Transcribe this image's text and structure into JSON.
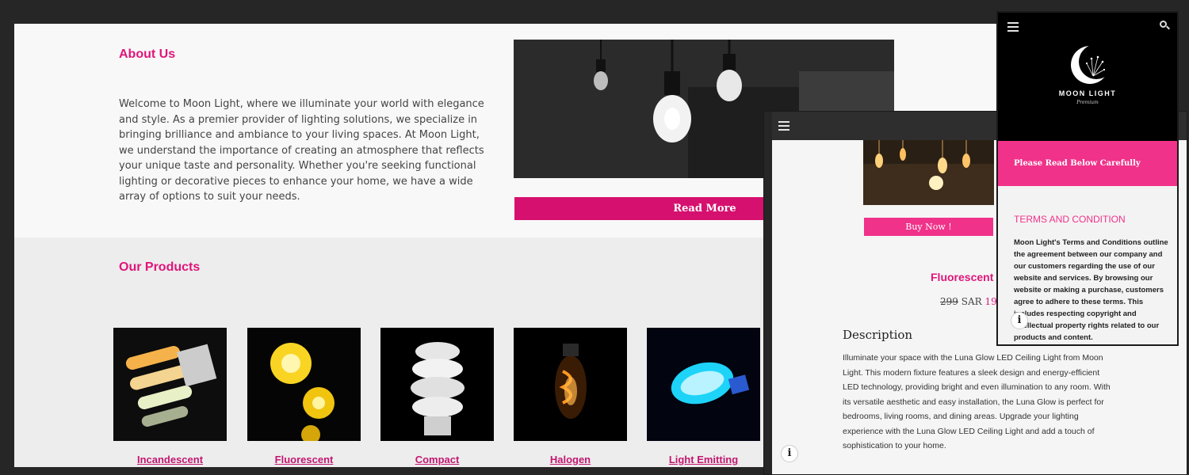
{
  "desktop": {
    "about": {
      "title": "About Us",
      "text": "Welcome to Moon Light, where we illuminate your world with elegance and style. As a premier provider of lighting solutions, we specialize in bringing brilliance and ambiance to your living spaces. At Moon Light, we understand the importance of creating an atmosphere that reflects your unique taste and personality. Whether you're seeking functional lighting or decorative pieces to enhance your home, we have a wide array of options to suit your needs.",
      "read_more_label": "Read More"
    },
    "products": {
      "title": "Our Products",
      "items": [
        {
          "label": "Incandescent"
        },
        {
          "label": "Fluorescent "
        },
        {
          "label": "Compact"
        },
        {
          "label": "Halogen"
        },
        {
          "label": " Light Emitting"
        }
      ]
    }
  },
  "product_window": {
    "buy_label": "Buy Now !",
    "name": "Fluorescent I",
    "old_price": "299",
    "currency": "SAR",
    "new_price": "19",
    "description_title": "Description",
    "description": "Illuminate your space with the Luna Glow LED Ceiling Light from Moon Light. This modern fixture features a sleek design and energy-efficient LED technology, providing bright and even illumination to any room. With its versatile aesthetic and easy installation, the Luna Glow is perfect for bedrooms, living rooms, and dining areas. Upgrade your lighting experience with the Luna Glow LED Ceiling Light and add a touch of sophistication to your home."
  },
  "terms_window": {
    "brand": "MOON LIGHT",
    "brand_sub": "Premium",
    "notice": "Please Read Below Carefully",
    "title": "TERMS AND CONDITION",
    "text": "Moon Light's Terms and Conditions outline the agreement between our company and our customers regarding the use of our website and services. By browsing our website or making a purchase, customers agree to adhere to these terms. This includes respecting copyright and intellectual property rights related to our products and content."
  },
  "colors": {
    "accent": "#e0157a",
    "button": "#d6106f",
    "pink_light": "#f0328a",
    "header_black": "#000000"
  },
  "icons": [
    "hamburger-menu-icon",
    "search-icon",
    "info-icon",
    "moon-logo-icon"
  ]
}
